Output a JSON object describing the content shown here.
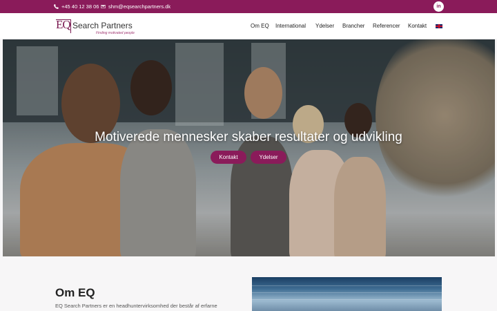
{
  "topbar": {
    "phone": "+45 40 12 38 06",
    "email": "shm@eqsearchpartners.dk",
    "linkedin_label": "in"
  },
  "logo": {
    "mark": "EQ",
    "name": "Search Partners",
    "tagline": "Finding motivated people"
  },
  "nav": {
    "items": [
      "Om EQ",
      "International",
      "Ydelser",
      "Brancher",
      "Referencer",
      "Kontakt"
    ],
    "language_icon": "uk-flag-icon"
  },
  "hero": {
    "title": "Motiverede mennesker skaber resultater og udvikling",
    "buttons": [
      "Kontakt",
      "Ydelser"
    ]
  },
  "about": {
    "title": "Om EQ",
    "text": "EQ Search Partners er en headhuntervirksomhed der består af erfarne"
  },
  "colors": {
    "brand": "#8a1b5a",
    "topbar_bg": "#8a1b5a",
    "button_bg": "#8a1b5a"
  }
}
